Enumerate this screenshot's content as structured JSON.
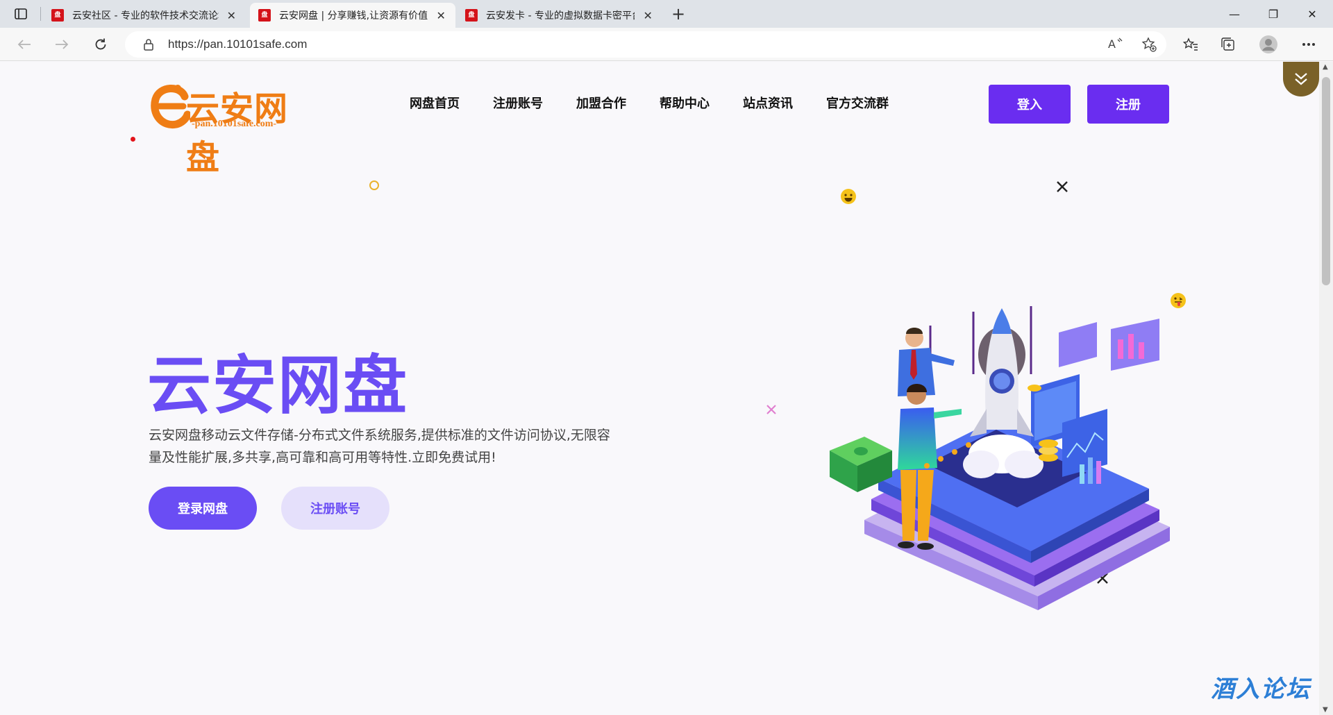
{
  "browser": {
    "tabs": [
      {
        "title": "云安社区 - 专业的软件技术交流论坛",
        "active": false
      },
      {
        "title": "云安网盘 | 分享赚钱,让资源有价值",
        "active": true
      },
      {
        "title": "云安发卡 - 专业的虚拟数据卡密平台",
        "active": false
      }
    ],
    "address": "https://pan.10101safe.com",
    "window_controls": {
      "minimize": "—",
      "restore": "❐",
      "close": "✕"
    },
    "new_tab": "+"
  },
  "site": {
    "logo_text": "云安网盘",
    "logo_subtitle": "-pan.10101safe.com-",
    "nav": [
      "网盘首页",
      "注册账号",
      "加盟合作",
      "帮助中心",
      "站点资讯",
      "官方交流群"
    ],
    "login_button": "登入",
    "register_button": "注册"
  },
  "hero": {
    "title": "云安网盘",
    "description": "云安网盘移动云文件存储-分布式文件系统服务,提供标准的文件访问协议,无限容量及性能扩展,多共享,高可靠和高可用等特性.立即免费试用!",
    "primary_button": "登录网盘",
    "secondary_button": "注册账号"
  },
  "watermark": "酒入论坛",
  "colors": {
    "accent": "#6a4df4",
    "button_purple": "#6a2df0",
    "logo_orange": "#ef7d15"
  }
}
